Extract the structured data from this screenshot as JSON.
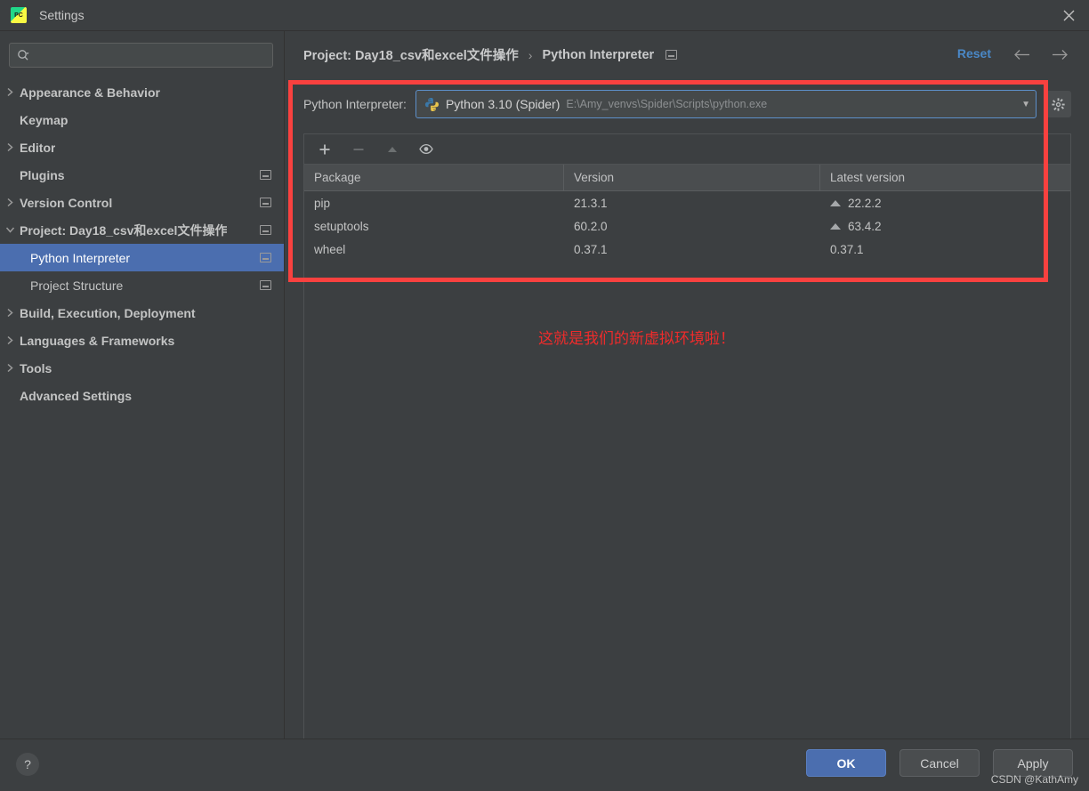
{
  "window": {
    "title": "Settings",
    "logo_icon": "pycharm-logo-icon",
    "close_icon": "close-icon"
  },
  "sidebar": {
    "search": {
      "placeholder": "",
      "value": "",
      "icon": "search-icon"
    },
    "items": [
      {
        "label": "Appearance & Behavior",
        "twisty": "chevron-right-icon",
        "bold": true,
        "indent": 0,
        "badge": false,
        "selected": false
      },
      {
        "label": "Keymap",
        "twisty": "",
        "bold": true,
        "indent": 0,
        "badge": false,
        "selected": false
      },
      {
        "label": "Editor",
        "twisty": "chevron-right-icon",
        "bold": true,
        "indent": 0,
        "badge": false,
        "selected": false
      },
      {
        "label": "Plugins",
        "twisty": "",
        "bold": true,
        "indent": 0,
        "badge": true,
        "selected": false
      },
      {
        "label": "Version Control",
        "twisty": "chevron-right-icon",
        "bold": true,
        "indent": 0,
        "badge": true,
        "selected": false
      },
      {
        "label": "Project: Day18_csv和excel文件操作",
        "twisty": "chevron-down-icon",
        "bold": true,
        "indent": 0,
        "badge": true,
        "selected": false
      },
      {
        "label": "Python Interpreter",
        "twisty": "",
        "bold": false,
        "indent": 1,
        "badge": true,
        "selected": true
      },
      {
        "label": "Project Structure",
        "twisty": "",
        "bold": false,
        "indent": 1,
        "badge": true,
        "selected": false
      },
      {
        "label": "Build, Execution, Deployment",
        "twisty": "chevron-right-icon",
        "bold": true,
        "indent": 0,
        "badge": false,
        "selected": false
      },
      {
        "label": "Languages & Frameworks",
        "twisty": "chevron-right-icon",
        "bold": true,
        "indent": 0,
        "badge": false,
        "selected": false
      },
      {
        "label": "Tools",
        "twisty": "chevron-right-icon",
        "bold": true,
        "indent": 0,
        "badge": false,
        "selected": false
      },
      {
        "label": "Advanced Settings",
        "twisty": "",
        "bold": true,
        "indent": 0,
        "badge": false,
        "selected": false
      }
    ]
  },
  "header": {
    "breadcrumb_project": "Project: Day18_csv和excel文件操作",
    "breadcrumb_separator": "›",
    "breadcrumb_page": "Python Interpreter",
    "reset_label": "Reset",
    "back_icon": "arrow-left-icon",
    "forward_icon": "arrow-right-icon"
  },
  "interpreter": {
    "label": "Python Interpreter:",
    "icon": "python-icon",
    "name": "Python 3.10 (Spider)",
    "path": "E:\\Amy_venvs\\Spider\\Scripts\\python.exe",
    "dropdown_icon": "chevron-down-icon",
    "settings_icon": "gear-icon"
  },
  "packages": {
    "toolbar": [
      {
        "icon": "plus-icon",
        "label": "+",
        "enabled": true
      },
      {
        "icon": "minus-icon",
        "label": "−",
        "enabled": false
      },
      {
        "icon": "upgrade-arrow-icon",
        "label": "▲",
        "enabled": false
      },
      {
        "icon": "eye-icon",
        "label": "◉",
        "enabled": true
      }
    ],
    "columns": [
      "Package",
      "Version",
      "Latest version"
    ],
    "rows": [
      {
        "package": "pip",
        "version": "21.3.1",
        "latest": "22.2.2",
        "upgradable": true
      },
      {
        "package": "setuptools",
        "version": "60.2.0",
        "latest": "63.4.2",
        "upgradable": true
      },
      {
        "package": "wheel",
        "version": "0.37.1",
        "latest": "0.37.1",
        "upgradable": false
      }
    ]
  },
  "annotation": {
    "text": "这就是我们的新虚拟环境啦！",
    "color": "#ef2b2b",
    "box_color": "#f9413f"
  },
  "footer": {
    "help_label": "?",
    "ok_label": "OK",
    "cancel_label": "Cancel",
    "apply_label": "Apply"
  },
  "watermark": {
    "text": "CSDN @KathAmy"
  },
  "colors": {
    "background": "#3c3f41",
    "selection": "#4b6eaf",
    "accent_link": "#4a88c7",
    "annotation_red": "#f9413f"
  }
}
